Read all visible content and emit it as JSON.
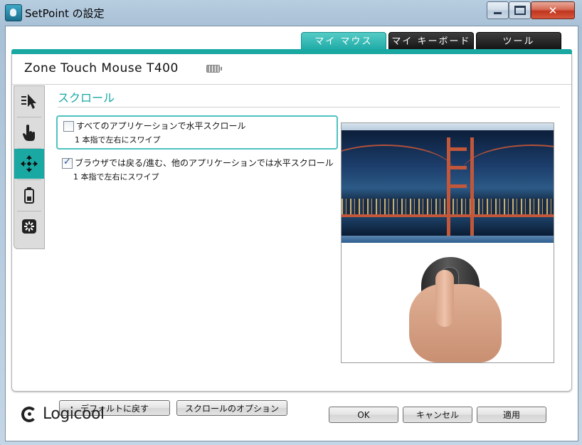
{
  "window": {
    "title": "SetPoint の設定",
    "min_icon": "minimize-icon",
    "max_icon": "maximize-icon",
    "close_symbol": "✕"
  },
  "tabs": [
    {
      "label": "マイ マウス",
      "active": true
    },
    {
      "label": "マイ キーボード",
      "active": false
    },
    {
      "label": "ツール",
      "active": false
    }
  ],
  "device": {
    "name": "Zone Touch Mouse T400",
    "battery_icon": "battery-icon"
  },
  "sidebar": {
    "items": [
      {
        "icon": "pointer-speed-icon",
        "active": false
      },
      {
        "icon": "touch-hand-icon",
        "active": false
      },
      {
        "icon": "scroll-arrows-icon",
        "active": true
      },
      {
        "icon": "battery-icon",
        "active": false
      },
      {
        "icon": "settings-gear-icon",
        "active": false
      }
    ]
  },
  "section": {
    "title": "スクロール",
    "options": [
      {
        "label": "すべてのアプリケーションで水平スクロール",
        "sub": "1 本指で左右にスワイプ",
        "checked": false
      },
      {
        "label": "ブラウザでは戻る/進む、他のアプリケーションでは水平スクロール",
        "sub": "1 本指で左右にスワイプ",
        "checked": true
      }
    ]
  },
  "buttons": {
    "default": "デフォルトに戻す",
    "scroll_options": "スクロールのオプション",
    "ok": "OK",
    "cancel": "キャンセル",
    "apply": "適用"
  },
  "brand": {
    "name": "Logicool"
  },
  "colors": {
    "accent": "#1aa8a3",
    "tab_dark": "#101010",
    "close_red": "#c0361f"
  }
}
